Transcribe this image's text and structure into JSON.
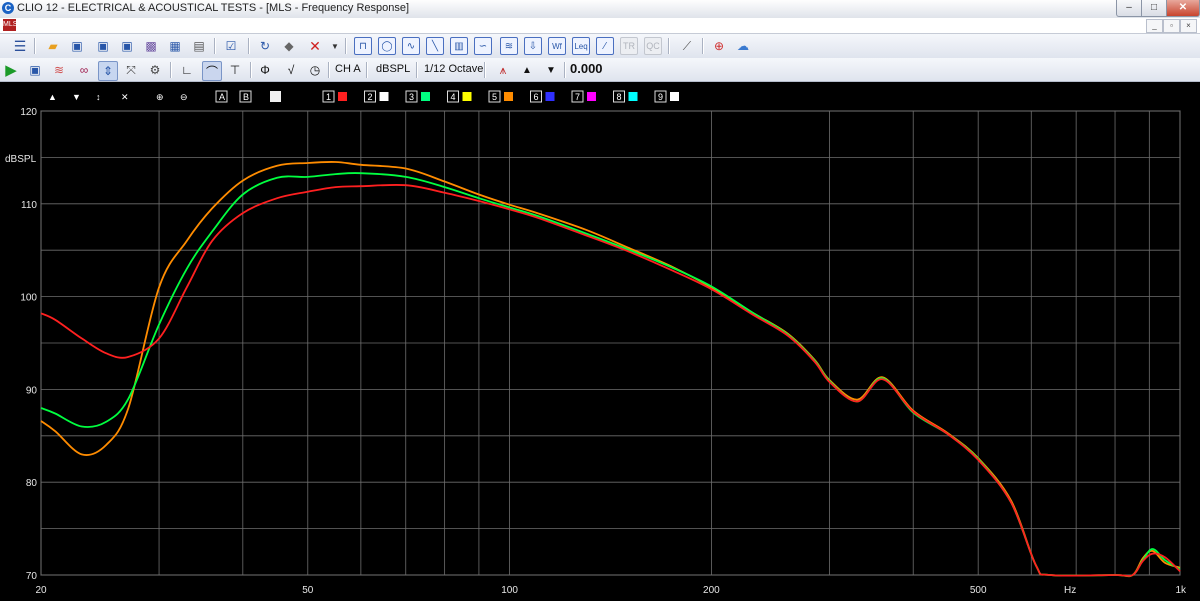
{
  "window": {
    "title": "CLIO 12 - ELECTRICAL & ACOUSTICAL TESTS - [MLS - Frequency Response]",
    "logo": "C",
    "min": "–",
    "max": "□",
    "close": "✕"
  },
  "mdi": {
    "doc_icon": "MLS",
    "min": "_",
    "restore": "▫",
    "close": "×"
  },
  "toolbar2": {
    "channel": "CH A",
    "unit": "dBSPL",
    "smoothing": "1/12 Octave",
    "up": "▲",
    "down": "▼",
    "value": "0.000"
  },
  "graph_toolbar": {
    "arrows": [
      "▲",
      "▼",
      "↕",
      "✕"
    ],
    "letters": [
      "A",
      "B"
    ],
    "overlays": [
      "1",
      "2",
      "3",
      "4",
      "5",
      "6",
      "7",
      "8",
      "9"
    ],
    "overlay_colors": [
      "#ff2020",
      "#ffffff",
      "#00ff80",
      "#ffff00",
      "#ff8c00",
      "#3030ff",
      "#ff00ff",
      "#00ffff",
      "#ffffff"
    ]
  },
  "chart_data": {
    "type": "line",
    "xscale": "log",
    "xlim": [
      20,
      1000
    ],
    "ylim": [
      70,
      120
    ],
    "ylabel": "dBSPL",
    "xlabel": "Hz",
    "grid": true,
    "x_ticks": [
      20,
      50,
      100,
      200,
      500,
      1000
    ],
    "x_tick_labels": [
      "20",
      "50",
      "100",
      "200",
      "500",
      "1k"
    ],
    "y_ticks": [
      120,
      110,
      100,
      90,
      80,
      70
    ],
    "y_tick_labels": [
      "120",
      "110",
      "100",
      "90",
      "80",
      "70"
    ],
    "series": [
      {
        "color": "#ff8c00",
        "x": [
          20,
          21,
          23,
          25,
          27,
          30,
          33,
          36,
          40,
          45,
          50,
          55,
          60,
          70,
          80,
          90,
          100,
          110,
          130,
          150,
          175,
          200,
          230,
          260,
          285,
          300,
          330,
          360,
          400,
          450,
          500,
          560,
          610,
          640,
          800,
          850,
          880,
          910,
          950,
          1000
        ],
        "y": [
          86.6,
          85.5,
          83,
          84,
          88,
          101,
          106,
          109.5,
          112.5,
          114.1,
          114.4,
          114.5,
          114.2,
          113.8,
          112.4,
          111,
          109.9,
          109,
          107.2,
          105.3,
          103.2,
          101,
          98.3,
          96,
          93.2,
          91,
          88.9,
          91.3,
          87.7,
          85.3,
          82.6,
          78,
          71,
          70,
          70,
          70,
          71.8,
          72.6,
          71.3,
          70.8
        ]
      },
      {
        "color": "#00ff40",
        "x": [
          20,
          21,
          23,
          25,
          27,
          30,
          33,
          36,
          40,
          45,
          50,
          55,
          60,
          70,
          80,
          90,
          100,
          110,
          130,
          150,
          175,
          200,
          230,
          260,
          285,
          300,
          330,
          360,
          400,
          450,
          500,
          560,
          610,
          640,
          800,
          850,
          880,
          910,
          950,
          1000
        ],
        "y": [
          88,
          87.4,
          86,
          86.5,
          89,
          97,
          103,
          107,
          111,
          112.8,
          112.9,
          113.2,
          113.3,
          112.9,
          111.8,
          110.6,
          109.6,
          108.7,
          106.8,
          105.1,
          103.1,
          101.1,
          98.3,
          95.9,
          93.1,
          90.9,
          88.7,
          91.2,
          87.5,
          85.2,
          82.5,
          77.8,
          71,
          70,
          70,
          70,
          71.6,
          72.8,
          71.6,
          70.6
        ]
      },
      {
        "color": "#ff2020",
        "x": [
          20,
          21,
          23,
          25,
          27,
          30,
          33,
          36,
          40,
          45,
          50,
          55,
          60,
          70,
          80,
          90,
          100,
          110,
          130,
          150,
          175,
          200,
          230,
          260,
          285,
          300,
          330,
          360,
          400,
          450,
          500,
          560,
          610,
          640,
          800,
          850,
          880,
          910,
          950,
          1000
        ],
        "y": [
          98.2,
          97.5,
          95.5,
          93.9,
          93.5,
          95.5,
          101,
          106,
          109,
          110.6,
          111.3,
          111.8,
          111.9,
          112,
          111.2,
          110.3,
          109.4,
          108.5,
          106.6,
          104.9,
          102.8,
          100.8,
          98.1,
          95.8,
          93,
          90.8,
          88.7,
          91.1,
          87.6,
          85.2,
          82.4,
          77.8,
          71,
          70,
          70,
          70,
          71.5,
          72.3,
          71.9,
          70.4
        ]
      }
    ]
  }
}
